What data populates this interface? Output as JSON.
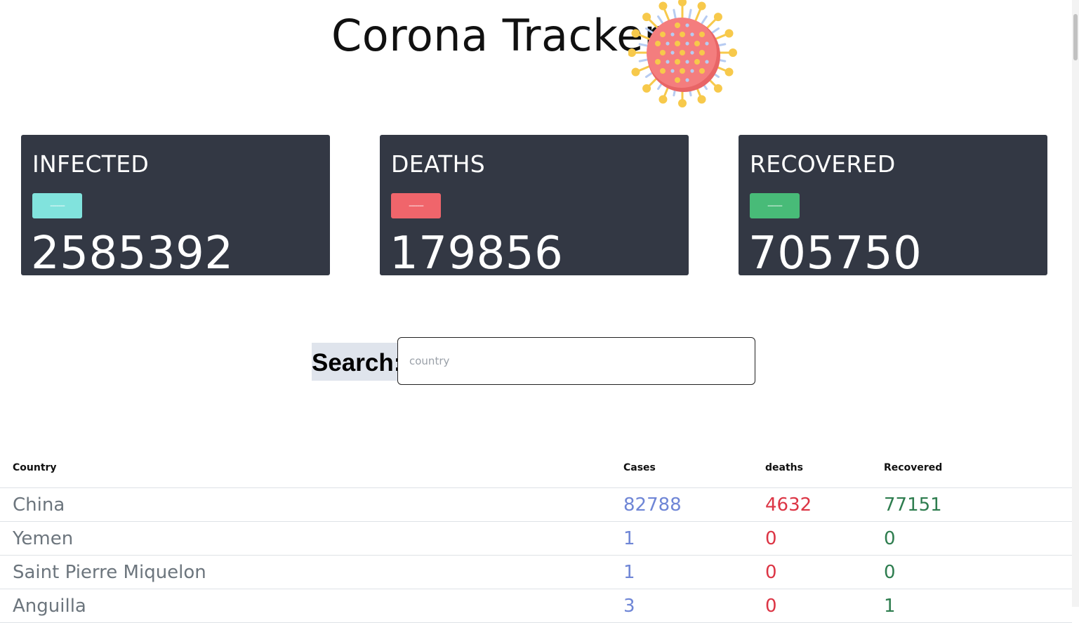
{
  "header": {
    "title": "Corona Tracker"
  },
  "cards": [
    {
      "label": "INFECTED",
      "badge": "-------",
      "value": "2585392",
      "color": "#81e3dd"
    },
    {
      "label": "DEATHS",
      "badge": "-------",
      "value": "179856",
      "color": "#f0656b"
    },
    {
      "label": "RECOVERED",
      "badge": "-------",
      "value": "705750",
      "color": "#48bb78"
    }
  ],
  "search": {
    "label": "Search:",
    "placeholder": "country"
  },
  "table": {
    "headers": [
      "Country",
      "Cases",
      "deaths",
      "Recovered"
    ],
    "rows": [
      {
        "country": "China",
        "cases": "82788",
        "deaths": "4632",
        "recovered": "77151"
      },
      {
        "country": "Yemen",
        "cases": "1",
        "deaths": "0",
        "recovered": "0"
      },
      {
        "country": "Saint Pierre Miquelon",
        "cases": "1",
        "deaths": "0",
        "recovered": "0"
      },
      {
        "country": "Anguilla",
        "cases": "3",
        "deaths": "0",
        "recovered": "1"
      }
    ]
  }
}
